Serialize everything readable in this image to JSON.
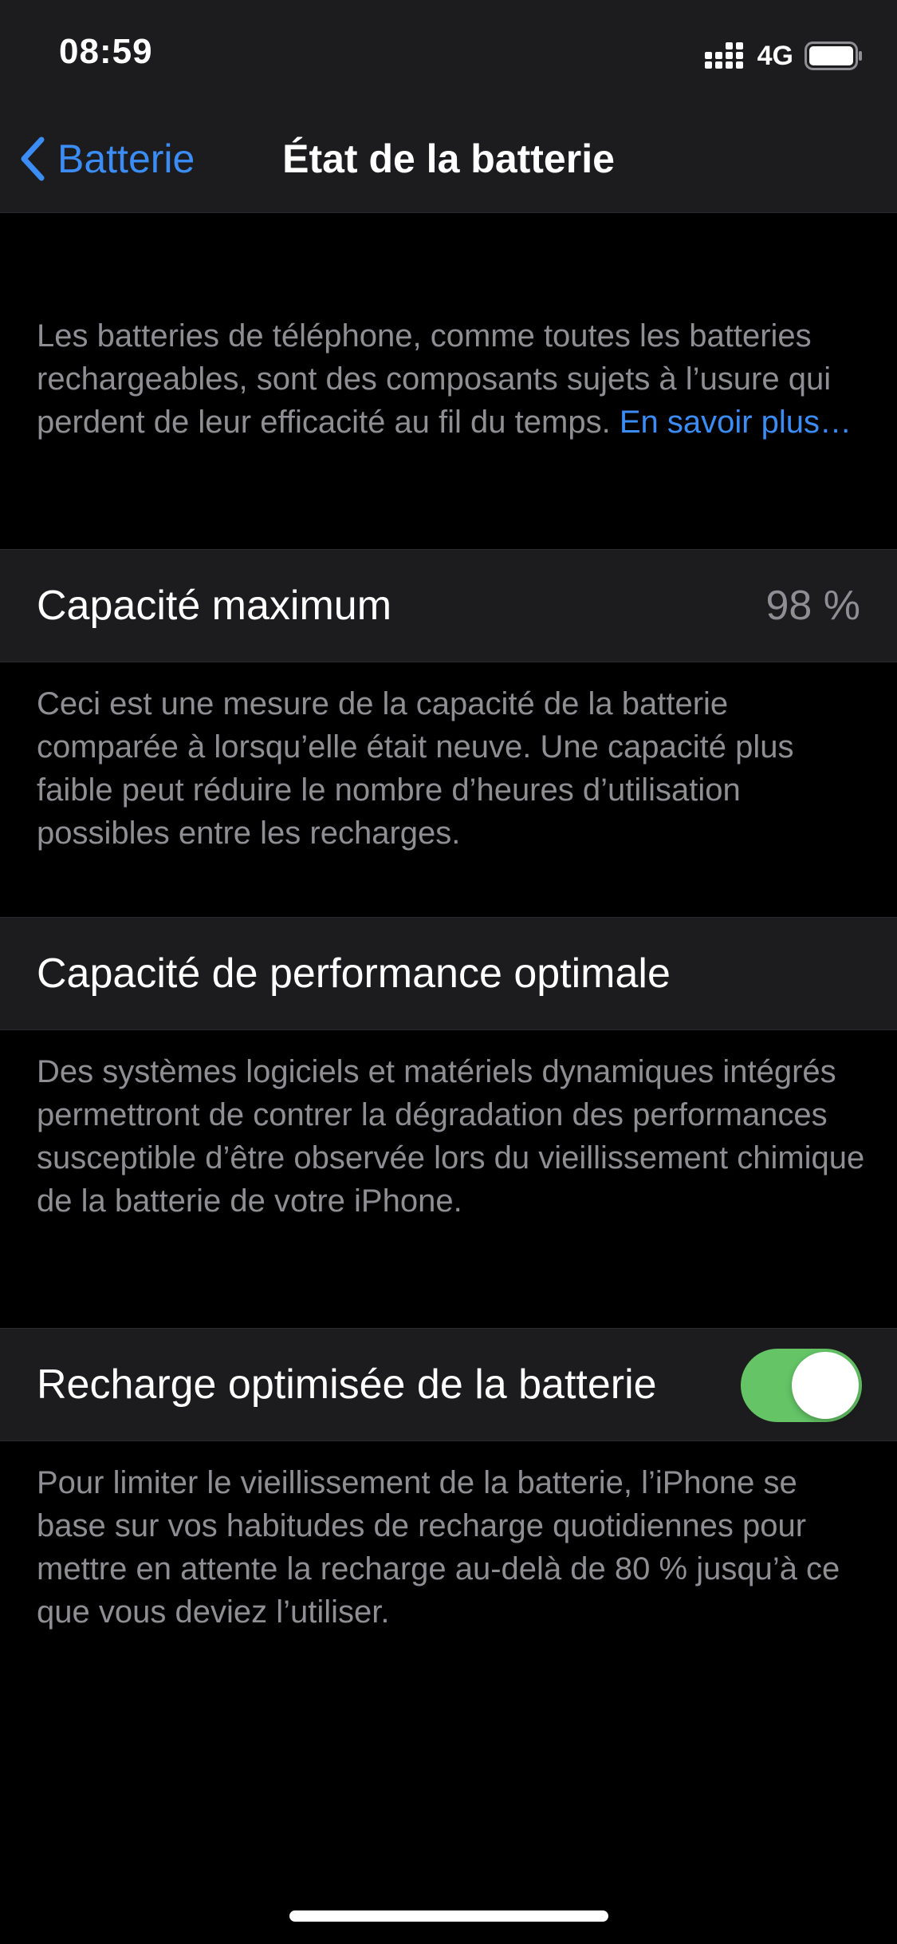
{
  "status_bar": {
    "time": "08:59",
    "network": "4G",
    "icons": [
      "signal-icon",
      "battery-icon"
    ]
  },
  "nav": {
    "back_label": "Batterie",
    "title": "État de la batterie",
    "back_icon": "chevron-left-icon"
  },
  "intro": {
    "text": "Les batteries de téléphone, comme toutes les batteries rechargeables, sont des composants sujets à l’usure qui perdent de leur efficacité au fil du temps.",
    "link_label": "En savoir plus…"
  },
  "max_capacity": {
    "label": "Capacité maximum",
    "value": "98 %",
    "description": "Ceci est une mesure de la capacité de la batterie comparée à lorsqu’elle était neuve. Une capacité plus faible peut réduire le nombre d’heures d’utilisation possibles entre les recharges."
  },
  "peak_performance": {
    "label": "Capacité de performance optimale",
    "description": "Des systèmes logiciels et matériels dynamiques intégrés permettront de contrer la dégradation des performances susceptible d’être observée lors du vieillissement chimique de la batterie de votre iPhone."
  },
  "optimized_charging": {
    "label": "Recharge optimisée de la batterie",
    "enabled": true,
    "description": "Pour limiter le vieillissement de la batterie, l’iPhone se base sur vos habitudes de recharge quotidiennes pour mettre en attente la recharge au-delà de 80 % jusqu’à ce que vous deviez l’utiliser."
  },
  "colors": {
    "background": "#000000",
    "cell_background": "#1c1c1e",
    "accent": "#3b8cf5",
    "secondary_text": "#8e8e93",
    "toggle_on": "#64c466"
  }
}
